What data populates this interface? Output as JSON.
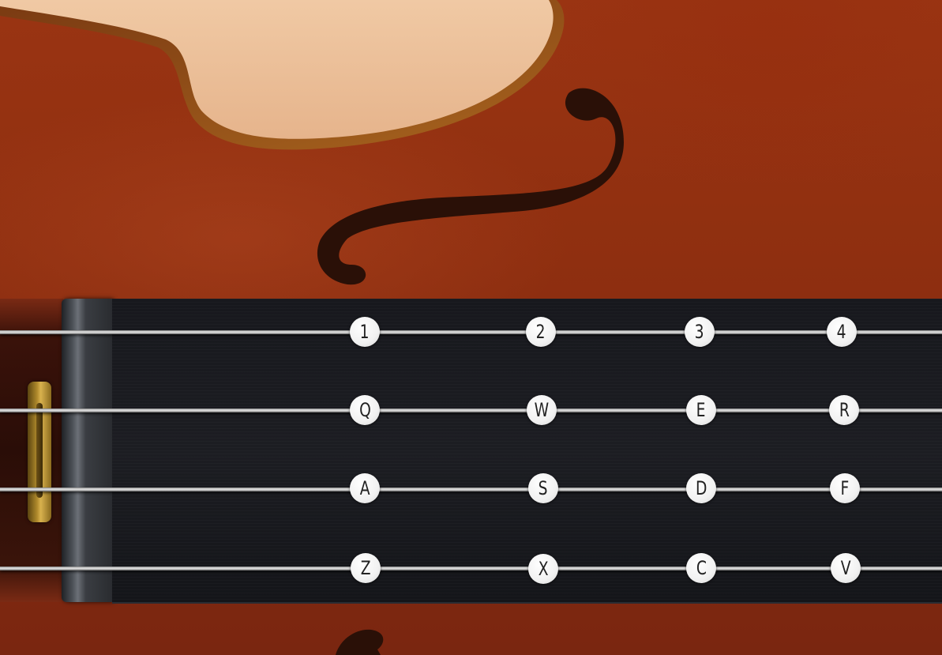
{
  "app": {
    "theme_colors": {
      "wood": "#8f2f10",
      "fingerboard": "#1a1b20",
      "string": "#d8d8d8",
      "key_face": "#f1f1f1",
      "key_text": "#222222",
      "brass": "#c39b3a"
    }
  },
  "strings": [
    {
      "keys": [
        "1",
        "2",
        "3",
        "4"
      ]
    },
    {
      "keys": [
        "Q",
        "W",
        "E",
        "R"
      ]
    },
    {
      "keys": [
        "A",
        "S",
        "D",
        "F"
      ]
    },
    {
      "keys": [
        "Z",
        "X",
        "C",
        "V"
      ]
    }
  ]
}
